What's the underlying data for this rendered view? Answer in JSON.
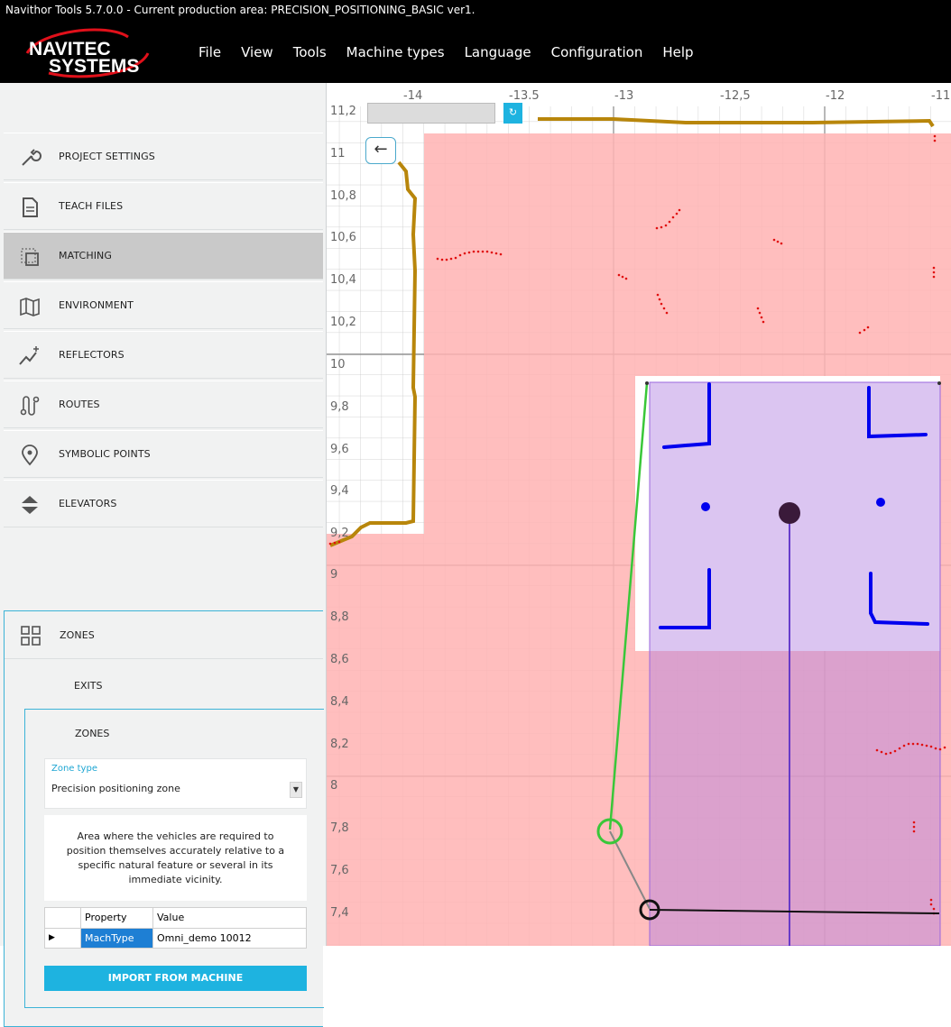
{
  "window": {
    "title": "Navithor Tools 5.7.0.0 - Current production area: PRECISION_POSITIONING_BASIC ver1."
  },
  "logo": {
    "line1": "NAVITEC",
    "line2": "SYSTEMS"
  },
  "menu": [
    "File",
    "View",
    "Tools",
    "Machine types",
    "Language",
    "Configuration",
    "Help"
  ],
  "sidebar": {
    "items": [
      {
        "label": "PROJECT SETTINGS",
        "icon": "wrench-icon"
      },
      {
        "label": "TEACH FILES",
        "icon": "document-icon"
      },
      {
        "label": "MATCHING",
        "icon": "matching-icon",
        "active": true
      },
      {
        "label": "ENVIRONMENT",
        "icon": "map-icon"
      },
      {
        "label": "REFLECTORS",
        "icon": "sparkle-chart-icon"
      },
      {
        "label": "ROUTES",
        "icon": "route-icon"
      },
      {
        "label": "SYMBOLIC POINTS",
        "icon": "location-pin-icon"
      },
      {
        "label": "ELEVATORS",
        "icon": "up-down-arrows-icon"
      },
      {
        "label": "ZONES",
        "icon": "grid-icon"
      }
    ],
    "zones_sub": {
      "exits_label": "EXITS",
      "zones_label": "ZONES",
      "zone_type_caption": "Zone type",
      "zone_type_value": "Precision positioning zone",
      "description": "Area where the vehicles are required to position themselves accurately relative to a specific natural feature or several in its immediate vicinity.",
      "table_headers": [
        "Property",
        "Value"
      ],
      "table_rows": [
        {
          "property": "MachType",
          "value": "Omni_demo 10012"
        }
      ],
      "import_button": "IMPORT FROM MACHINE"
    }
  },
  "map": {
    "x_ticks": [
      "-14",
      "-13.5",
      "-13",
      "-12,5",
      "-12",
      "-11"
    ],
    "y_ticks": [
      "11,2",
      "11",
      "10,8",
      "10,6",
      "10,4",
      "10,2",
      "10",
      "9,8",
      "9,6",
      "9,4",
      "9,2",
      "9",
      "8,8",
      "8,6",
      "8,4",
      "8,2",
      "8",
      "7,8",
      "7,6",
      "7,4"
    ],
    "colors": {
      "zone_red": "#ffb8b8",
      "zone_purple": "#c9a8f0",
      "wall": "#b8860b",
      "reflector": "#0000ee",
      "route_green": "#39c739"
    }
  }
}
